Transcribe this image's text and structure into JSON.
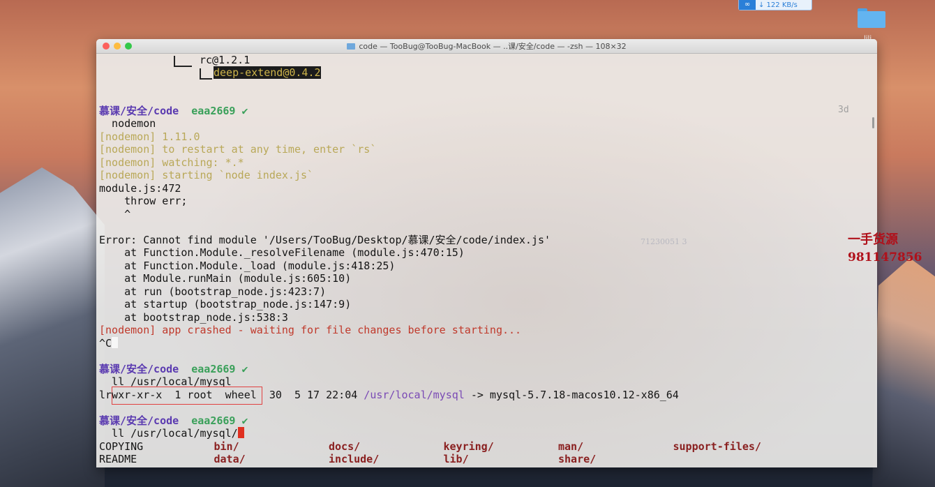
{
  "desktop": {
    "net_speed": "↓ 122 KB/s",
    "folder_label": "lili"
  },
  "window": {
    "title": "code — TooBug@TooBug-MacBook — ..课/安全/code — -zsh — 108×32",
    "time_hint": "3d"
  },
  "terminal": {
    "lines": {
      "rc": "rc@1.2.1",
      "deep": "deep-extend@0.4.2",
      "p1_path": "慕课/安全/code",
      "p1_git": "eaa2669",
      "check": "✔",
      "cmd_nodemon": "  nodemon",
      "nm1": "[nodemon] 1.11.0",
      "nm2": "[nodemon] to restart at any time, enter `rs`",
      "nm3": "[nodemon] watching: *.*",
      "nm4": "[nodemon] starting `node index.js`",
      "mod": "module.js:472",
      "throw": "    throw err;",
      "caret": "    ^",
      "err": "Error: Cannot find module '/Users/TooBug/Desktop/慕课/安全/code/index.js'",
      "at1": "    at Function.Module._resolveFilename (module.js:470:15)",
      "at2": "    at Function.Module._load (module.js:418:25)",
      "at3": "    at Module.runMain (module.js:605:10)",
      "at4": "    at run (bootstrap_node.js:423:7)",
      "at5": "    at startup (bootstrap_node.js:147:9)",
      "at6": "    at bootstrap_node.js:538:3",
      "crash": "[nodemon] app crashed - waiting for file changes before starting...",
      "ctrlc": "^C",
      "cmd_ll1": "  ll /usr/local/mysql",
      "ls_a": "lrwxr-xr-x  1 root  wheel  30  5 17 22:04 ",
      "ls_link": "/usr/local/mysql",
      "ls_arrow": " -> mysql-5.7.18-macos10.12-x86_64",
      "cmd_ll2": "  ll /usr/local/mysql/"
    },
    "listing_row1": [
      "COPYING",
      "bin/",
      "docs/",
      "keyring/",
      "man/",
      "support-files/"
    ],
    "listing_row2": [
      "README",
      "data/",
      "include/",
      "lib/",
      "share/"
    ]
  },
  "overlay": {
    "faint_code": "71230051 3",
    "watermark_line1": "一手货源",
    "watermark_line2": "981147856"
  }
}
